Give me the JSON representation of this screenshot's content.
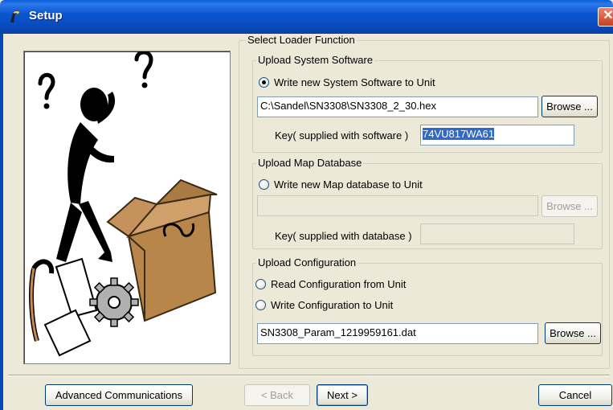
{
  "window": {
    "title": "Setup",
    "close_glyph": "✕"
  },
  "group_main": {
    "title": "Select Loader Function"
  },
  "system": {
    "title": "Upload System Software",
    "radio_label": "Write new System Software to Unit",
    "file_path": "C:\\Sandel\\SN3308\\SN3308_2_30.hex",
    "browse_label": "Browse ...",
    "key_label": "Key( supplied with software )",
    "key_value": "74VU817WA61"
  },
  "map": {
    "title": "Upload Map Database",
    "radio_label": "Write new Map database to Unit",
    "file_path": "",
    "browse_label": "Browse ...",
    "key_label": "Key( supplied with database )",
    "key_value": ""
  },
  "config": {
    "title": "Upload Configuration",
    "read_label": "Read Configuration from Unit",
    "write_label": "Write Configuration to Unit",
    "file_path": "SN3308_Param_1219959161.dat",
    "browse_label": "Browse ..."
  },
  "footer": {
    "advanced_label": "Advanced Communications",
    "back_label": "< Back",
    "next_label": "Next >",
    "cancel_label": "Cancel"
  },
  "icons": {
    "app_icon": "setup-app-icon",
    "illustration": "confused-person-box-illustration"
  },
  "colors": {
    "titlebar": "#0847b8",
    "selection": "#316ac5",
    "radio_checked": "#000000"
  }
}
